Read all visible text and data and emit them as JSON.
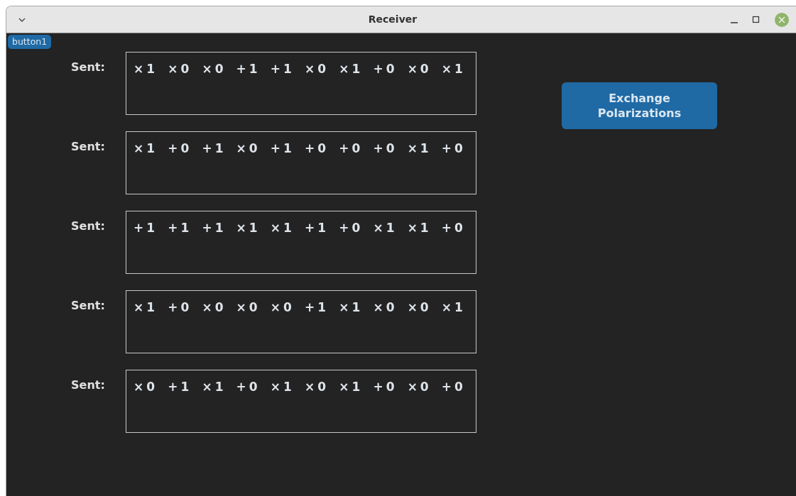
{
  "window": {
    "title": "Receiver"
  },
  "corner_button": {
    "label": "button1"
  },
  "rows": [
    {
      "label": "Sent:",
      "bits": [
        "×1",
        "×0",
        "×0",
        "+1",
        "+1",
        "×0",
        "×1",
        "+0",
        "×0",
        "×1"
      ]
    },
    {
      "label": "Sent:",
      "bits": [
        "×1",
        "+0",
        "+1",
        "×0",
        "+1",
        "+0",
        "+0",
        "+0",
        "×1",
        "+0"
      ]
    },
    {
      "label": "Sent:",
      "bits": [
        "+1",
        "+1",
        "+1",
        "×1",
        "×1",
        "+1",
        "+0",
        "×1",
        "×1",
        "+0"
      ]
    },
    {
      "label": "Sent:",
      "bits": [
        "×1",
        "+0",
        "×0",
        "×0",
        "×0",
        "+1",
        "×1",
        "×0",
        "×0",
        "×1"
      ]
    },
    {
      "label": "Sent:",
      "bits": [
        "×0",
        "+1",
        "×1",
        "+0",
        "×1",
        "×0",
        "×1",
        "+0",
        "×0",
        "+0"
      ]
    }
  ],
  "action_button": {
    "label": "Exchange Polarizations"
  }
}
